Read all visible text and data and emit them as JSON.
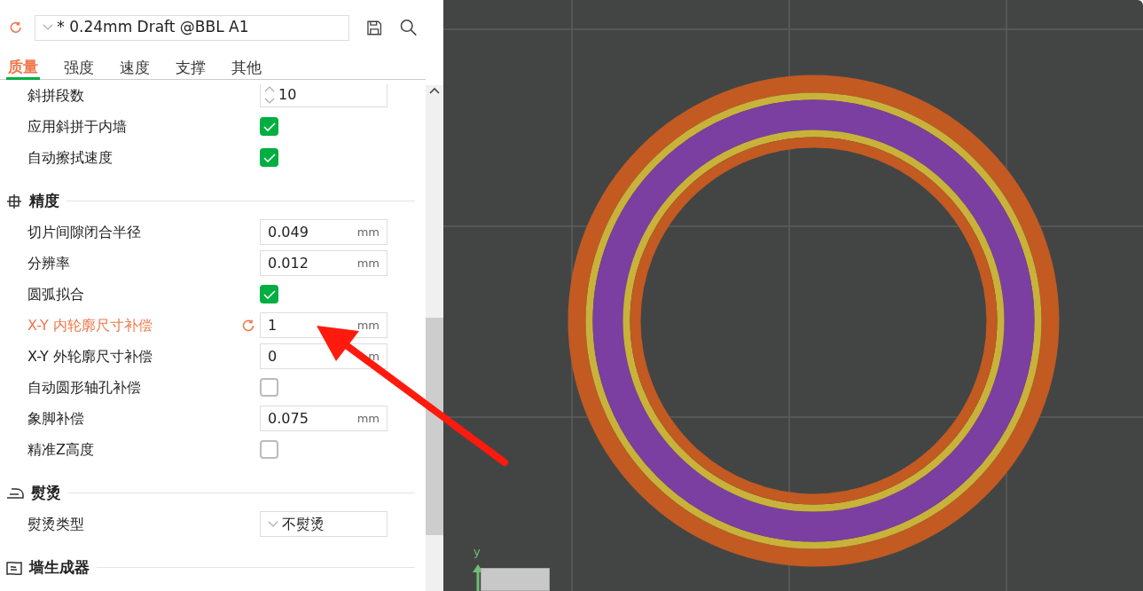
{
  "preset": {
    "value": "* 0.24mm Draft @BBL A1"
  },
  "tabs": [
    {
      "label": "质量",
      "selected": true
    },
    {
      "label": "强度",
      "selected": false
    },
    {
      "label": "速度",
      "selected": false
    },
    {
      "label": "支撑",
      "selected": false
    },
    {
      "label": "其他",
      "selected": false
    }
  ],
  "sections": [
    {
      "items": [
        {
          "kind": "spin",
          "label": "斜拼段数",
          "value": "10",
          "modified": false
        },
        {
          "kind": "checkbox",
          "label": "应用斜拼于内墙",
          "checked": true,
          "modified": false
        },
        {
          "kind": "checkbox",
          "label": "自动擦拭速度",
          "checked": true,
          "modified": false
        }
      ]
    },
    {
      "title": "精度",
      "kind": "precision",
      "items": [
        {
          "kind": "number",
          "label": "切片间隙闭合半径",
          "value": "0.049",
          "unit": "mm",
          "modified": false
        },
        {
          "kind": "number",
          "label": "分辨率",
          "value": "0.012",
          "unit": "mm",
          "modified": false
        },
        {
          "kind": "checkbox",
          "label": "圆弧拟合",
          "checked": true,
          "modified": false
        },
        {
          "kind": "number",
          "label": "X-Y 内轮廓尺寸补偿",
          "value": "1",
          "unit": "mm",
          "modified": true
        },
        {
          "kind": "number",
          "label": "X-Y 外轮廓尺寸补偿",
          "value": "0",
          "unit": "m",
          "modified": false
        },
        {
          "kind": "checkbox",
          "label": "自动圆形轴孔补偿",
          "checked": false,
          "modified": false
        },
        {
          "kind": "number",
          "label": "象脚补偿",
          "value": "0.075",
          "unit": "mm",
          "modified": false
        },
        {
          "kind": "checkbox",
          "label": "精准Z高度",
          "checked": false,
          "modified": false
        }
      ]
    },
    {
      "title": "熨烫",
      "kind": "iron",
      "items": [
        {
          "kind": "dropdown",
          "label": "熨烫类型",
          "value": "不熨烫",
          "modified": false
        }
      ]
    },
    {
      "title": "墙生成器",
      "kind": "wall"
    }
  ],
  "viewport": {
    "axis_label": "y"
  }
}
